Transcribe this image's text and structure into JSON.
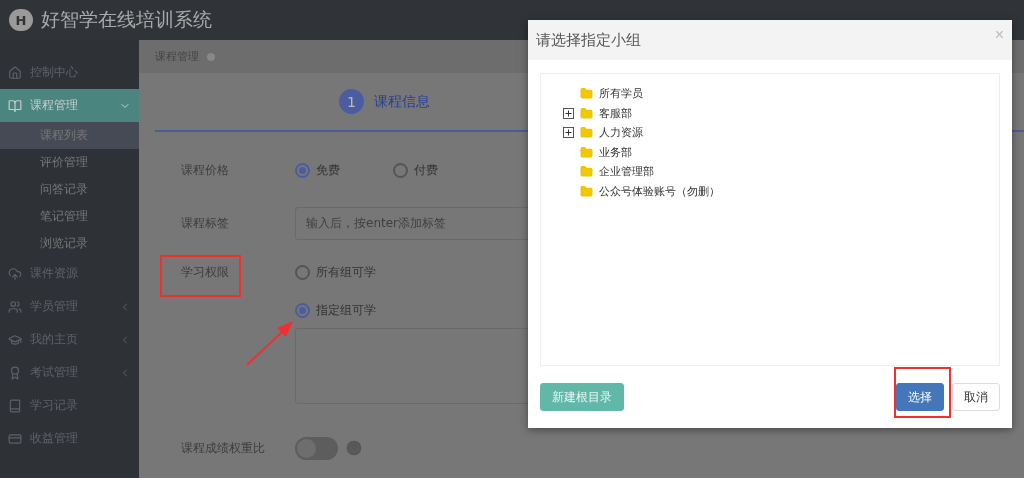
{
  "app_title": "好智学在线培训系统",
  "logo_letter": "H",
  "sidebar": {
    "items": [
      {
        "label": "控制中心",
        "kind": "plain",
        "selected": false
      },
      {
        "label": "课程管理",
        "kind": "menu",
        "selected": true,
        "expanded": true,
        "children": [
          {
            "label": "课程列表",
            "selected": true
          },
          {
            "label": "评价管理",
            "selected": false
          },
          {
            "label": "问答记录",
            "selected": false
          },
          {
            "label": "笔记管理",
            "selected": false
          },
          {
            "label": "浏览记录",
            "selected": false
          }
        ]
      },
      {
        "label": "课件资源",
        "kind": "plain",
        "selected": false
      },
      {
        "label": "学员管理",
        "kind": "menu",
        "selected": false,
        "expanded": false
      },
      {
        "label": "我的主页",
        "kind": "menu",
        "selected": false,
        "expanded": false
      },
      {
        "label": "考试管理",
        "kind": "menu",
        "selected": false,
        "expanded": false
      },
      {
        "label": "学习记录",
        "kind": "plain",
        "selected": false
      },
      {
        "label": "收益管理",
        "kind": "plain",
        "selected": false
      }
    ]
  },
  "breadcrumb": "课程管理",
  "step": {
    "number": "1",
    "label": "课程信息"
  },
  "form": {
    "price": {
      "label": "课程价格",
      "options": [
        {
          "label": "免费",
          "selected": true
        },
        {
          "label": "付费",
          "selected": false
        }
      ]
    },
    "tags": {
      "label": "课程标签",
      "placeholder": "输入后，按enter添加标签"
    },
    "permission": {
      "label": "学习权限",
      "options": [
        {
          "label": "所有组可学",
          "selected": false
        },
        {
          "label": "指定组可学",
          "selected": true
        }
      ]
    },
    "weight": {
      "label": "课程成绩权重比",
      "on": false
    }
  },
  "dialog": {
    "title": "请选择指定小组",
    "close": "×",
    "tree": [
      {
        "label": "所有学员",
        "kind": "leaf"
      },
      {
        "label": "客服部",
        "kind": "branch",
        "expanded": false
      },
      {
        "label": "人力资源",
        "kind": "branch",
        "expanded": false
      },
      {
        "label": "业务部",
        "kind": "leaf"
      },
      {
        "label": "企业管理部",
        "kind": "leaf"
      },
      {
        "label": "公众号体验账号（勿删）",
        "kind": "leaf"
      }
    ],
    "new_root_button": "新建根目录",
    "select_button": "选择",
    "cancel_button": "取消"
  }
}
